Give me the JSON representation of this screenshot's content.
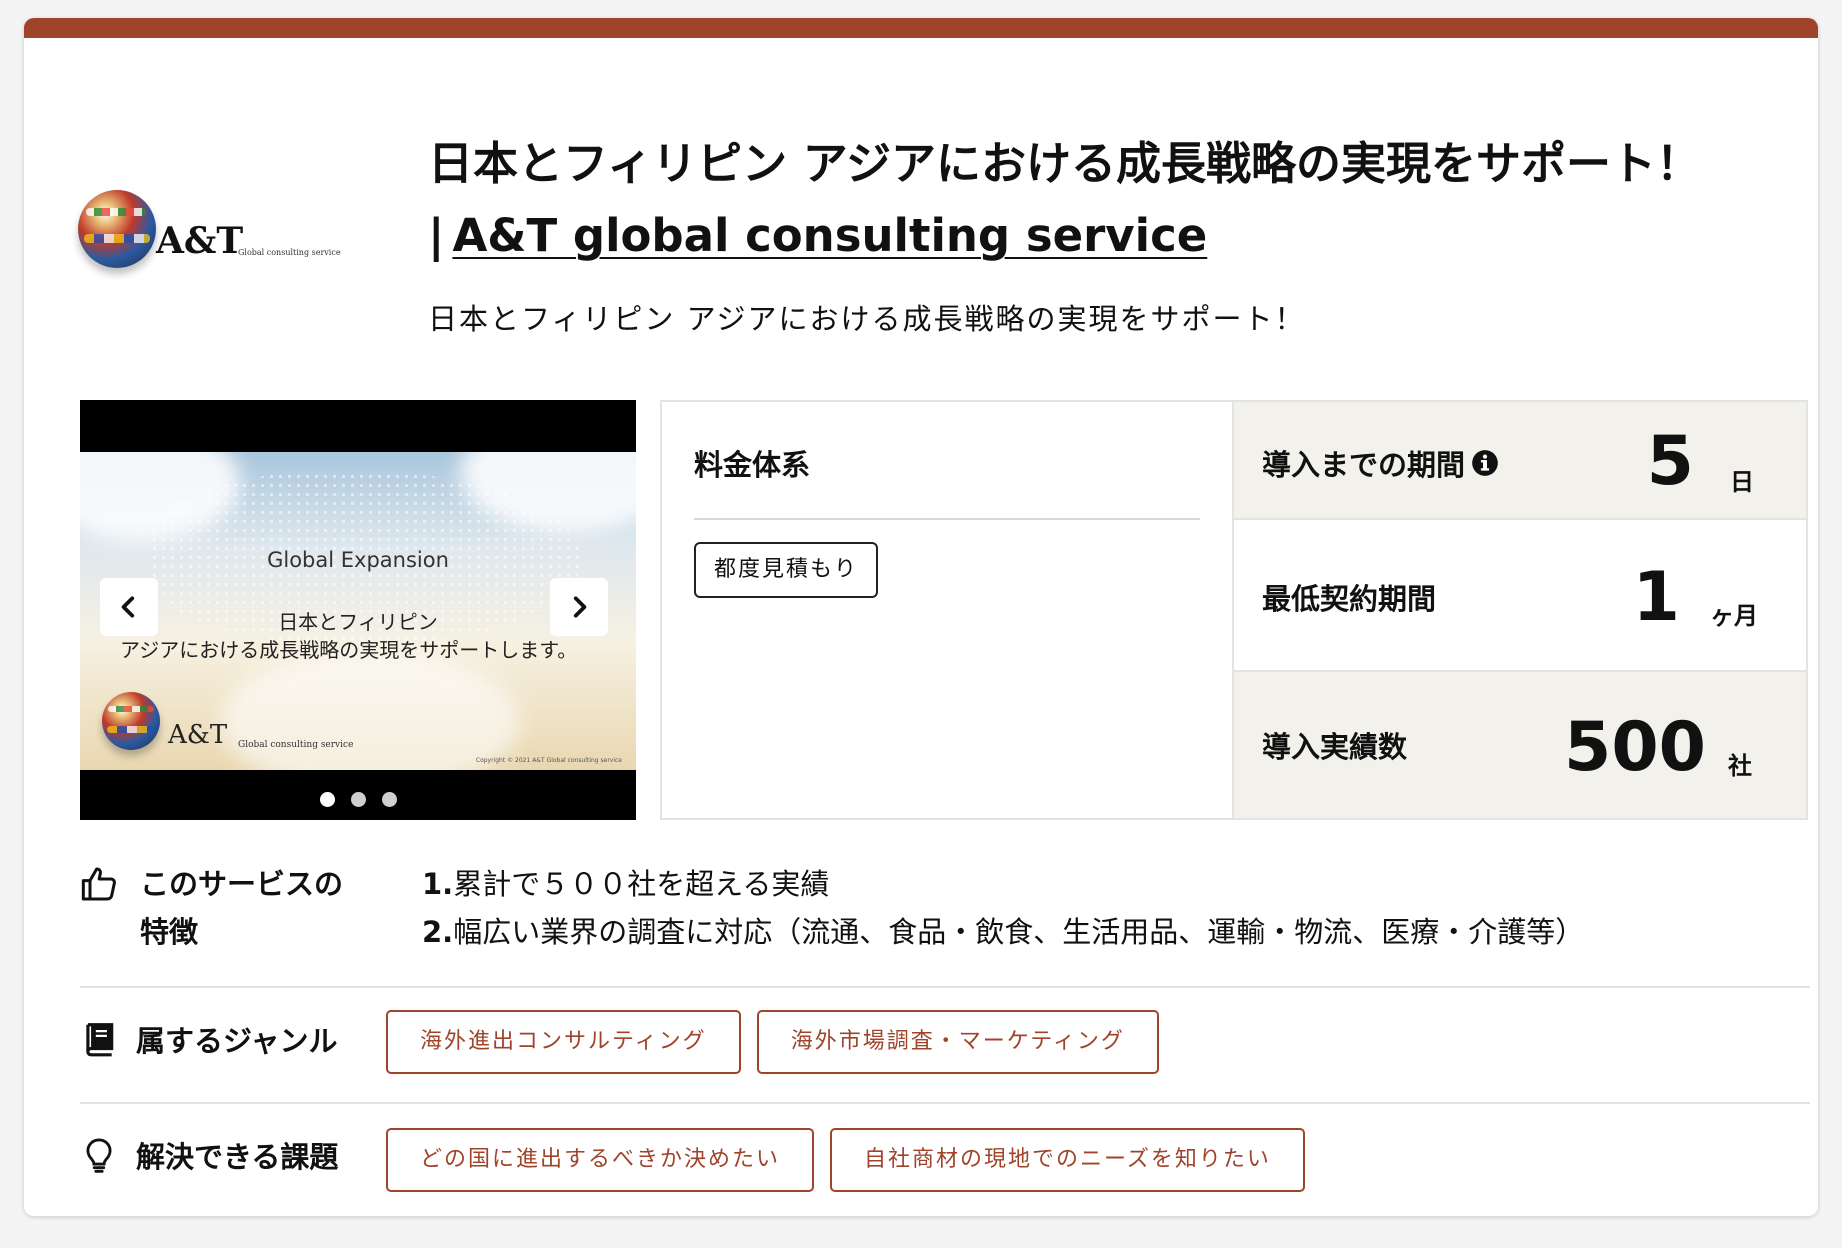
{
  "header": {
    "title_line1": "日本とフィリピン アジアにおける成長戦略の実現をサポート！",
    "title_sep": "|",
    "title_link": "A&T global consulting service",
    "subtitle": "日本とフィリピン アジアにおける成長戦略の実現をサポート！"
  },
  "logo": {
    "text": "A&T",
    "sub": "Global consulting service"
  },
  "carousel": {
    "heading": "Global Expansion",
    "line1": "日本とフィリピン",
    "line2": "アジアにおける成長戦略の実現をサポートします。",
    "logo_text": "A&T",
    "logo_sub": "Global consulting service",
    "copyright": "Copyright © 2021 A&T Global consulting service",
    "slide_count": 3,
    "active_index": 0
  },
  "pricing": {
    "heading": "料金体系",
    "tag": "都度見積もり"
  },
  "stats": [
    {
      "label": "導入までの期間",
      "value": "5",
      "unit": "日",
      "has_info": true
    },
    {
      "label": "最低契約期間",
      "value": "1",
      "unit": "ヶ月",
      "has_info": false
    },
    {
      "label": "導入実績数",
      "value": "500",
      "unit": "社",
      "has_info": false
    }
  ],
  "features": {
    "label_line1": "このサービスの",
    "label_line2": "特徴",
    "items": [
      {
        "num": "1.",
        "text": "累計で５００社を超える実績"
      },
      {
        "num": "2.",
        "text": "幅広い業界の調査に対応（流通、食品・飲食、生活用品、運輸・物流、医療・介護等）"
      }
    ]
  },
  "genres": {
    "label": "属するジャンル",
    "tags": [
      "海外進出コンサルティング",
      "海外市場調査・マーケティング"
    ]
  },
  "issues": {
    "label": "解決できる課題",
    "tags": [
      "どの国に進出するべきか決めたい",
      "自社商材の現地でのニーズを知りたい"
    ]
  },
  "colors": {
    "accent": "#a0432b",
    "stat_bg": "#f3f1ec"
  }
}
